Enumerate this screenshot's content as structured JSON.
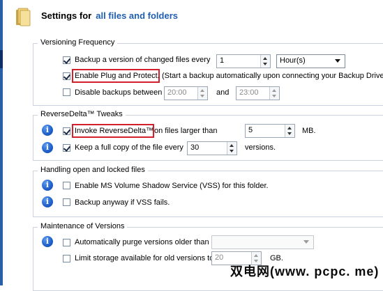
{
  "header": {
    "title_prefix": "Settings for",
    "title_target": "all files and folders",
    "icon": "folder-icon"
  },
  "versioning": {
    "legend": "Versioning Frequency",
    "backup_label": "Backup a version of changed files every",
    "backup_checked": true,
    "backup_every_value": "1",
    "backup_unit": "Hour(s)",
    "plug_protect_label": "Enable Plug and Protect.",
    "plug_protect_hint": "(Start a backup automatically upon connecting your Backup Drive)",
    "plug_protect_checked": true,
    "disable_label": "Disable backups between",
    "disable_checked": false,
    "disable_from": "20:00",
    "disable_and": "and",
    "disable_to": "23:00"
  },
  "reversedelta": {
    "legend": "ReverseDelta™ Tweaks",
    "invoke_label": "Invoke ReverseDelta™",
    "invoke_suffix": "on files larger than",
    "invoke_checked": true,
    "invoke_value": "5",
    "invoke_unit": "MB.",
    "full_copy_label": "Keep a full copy of the file every",
    "full_copy_checked": true,
    "full_copy_value": "30",
    "full_copy_unit": "versions."
  },
  "open_locked": {
    "legend": "Handling open and locked files",
    "vss_label": "Enable MS Volume Shadow Service (VSS) for this folder.",
    "vss_checked": false,
    "anyway_label": "Backup anyway if VSS fails.",
    "anyway_checked": false
  },
  "maintenance": {
    "legend": "Maintenance of Versions",
    "purge_label": "Automatically purge versions older than",
    "purge_checked": false,
    "purge_value": "",
    "limit_label": "Limit storage available for old versions to",
    "limit_checked": false,
    "limit_value": "20",
    "limit_unit": "GB."
  },
  "watermark": "双电网(www. pcpc. me)",
  "colors": {
    "accent": "#1f5eb0",
    "highlight_box": "#d21f2a",
    "info_icon": "#1d5ec9"
  }
}
